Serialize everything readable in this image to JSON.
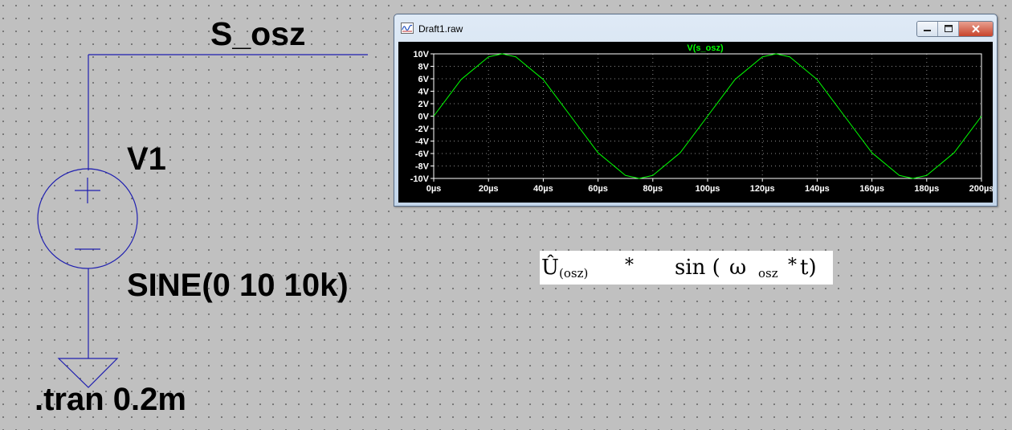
{
  "schematic": {
    "net_label": "S_osz",
    "instance_name": "V1",
    "source_value": "SINE(0 10 10k)",
    "directive": ".tran 0.2m",
    "wire_color": "#1f1fb0"
  },
  "plot_window": {
    "title": "Draft1.raw",
    "trace_label": "V(s_osz)",
    "trace_color": "#00ff00"
  },
  "chart_data": {
    "type": "line",
    "title": "V(s_osz)",
    "xlabel": "",
    "ylabel": "",
    "x_ticks": [
      "0µs",
      "20µs",
      "40µs",
      "60µs",
      "80µs",
      "100µs",
      "120µs",
      "140µs",
      "160µs",
      "180µs",
      "200µs"
    ],
    "y_ticks": [
      "10V",
      "8V",
      "6V",
      "4V",
      "2V",
      "0V",
      "-2V",
      "-4V",
      "-6V",
      "-8V",
      "-10V"
    ],
    "xlim": [
      0,
      200
    ],
    "ylim": [
      -10,
      10
    ],
    "x_unit": "µs",
    "y_unit": "V",
    "grid": true,
    "series": [
      {
        "name": "V(s_osz)",
        "color": "#00ff00",
        "x": [
          0,
          10,
          20,
          25,
          30,
          40,
          50,
          60,
          70,
          75,
          80,
          90,
          100,
          110,
          120,
          125,
          130,
          140,
          150,
          160,
          170,
          175,
          180,
          190,
          200
        ],
        "y": [
          0,
          5.88,
          9.51,
          10,
          9.51,
          5.88,
          0,
          -5.88,
          -9.51,
          -10,
          -9.51,
          -5.88,
          0,
          5.88,
          9.51,
          10,
          9.51,
          5.88,
          0,
          -5.88,
          -9.51,
          -10,
          -9.51,
          -5.88,
          0
        ]
      }
    ]
  },
  "formula": {
    "amplitude": "Û",
    "amplitude_sub": "(osz)",
    "operator": "*",
    "sin": "sin (",
    "omega": "ω",
    "omega_sub": "osz",
    "operator2": "*",
    "time": "t)"
  }
}
